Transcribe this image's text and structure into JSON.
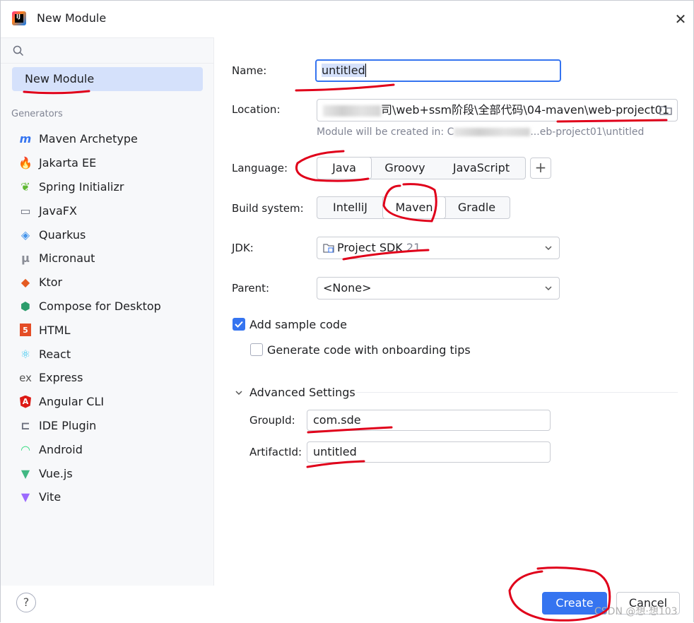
{
  "window": {
    "title": "New Module"
  },
  "sidebar": {
    "selected": "New Module",
    "section_label": "Generators",
    "generators": [
      {
        "label": "Maven Archetype",
        "icon": "maven-icon"
      },
      {
        "label": "Jakarta EE",
        "icon": "jakarta-icon"
      },
      {
        "label": "Spring Initializr",
        "icon": "spring-icon"
      },
      {
        "label": "JavaFX",
        "icon": "javafx-icon"
      },
      {
        "label": "Quarkus",
        "icon": "quarkus-icon"
      },
      {
        "label": "Micronaut",
        "icon": "micronaut-icon"
      },
      {
        "label": "Ktor",
        "icon": "ktor-icon"
      },
      {
        "label": "Compose for Desktop",
        "icon": "compose-icon"
      },
      {
        "label": "HTML",
        "icon": "html5-icon"
      },
      {
        "label": "React",
        "icon": "react-icon"
      },
      {
        "label": "Express",
        "icon": "express-icon"
      },
      {
        "label": "Angular CLI",
        "icon": "angular-icon"
      },
      {
        "label": "IDE Plugin",
        "icon": "plugin-icon"
      },
      {
        "label": "Android",
        "icon": "android-icon"
      },
      {
        "label": "Vue.js",
        "icon": "vue-icon"
      },
      {
        "label": "Vite",
        "icon": "vite-icon"
      }
    ]
  },
  "form": {
    "name_label": "Name:",
    "name_value": "untitled",
    "location_label": "Location:",
    "location_value": "司\\web+ssm阶段\\全部代码\\04-maven\\web-project01",
    "location_hint_prefix": "Module will be created in: C",
    "location_hint_suffix": "...eb-project01\\untitled",
    "language_label": "Language:",
    "languages": [
      "Java",
      "Groovy",
      "JavaScript"
    ],
    "language_selected": "Java",
    "add_language": "+",
    "build_label": "Build system:",
    "builds": [
      "IntelliJ",
      "Maven",
      "Gradle"
    ],
    "build_selected": "Maven",
    "jdk_label": "JDK:",
    "jdk_value": "Project SDK",
    "jdk_version": "21",
    "parent_label": "Parent:",
    "parent_value": "<None>",
    "sample_code_label": "Add sample code",
    "onboarding_label": "Generate code with onboarding tips",
    "advanced_label": "Advanced Settings",
    "groupid_label": "GroupId:",
    "groupid_value": "com.sde",
    "artifactid_label": "ArtifactId:",
    "artifactid_value": "untitled"
  },
  "buttons": {
    "create": "Create",
    "cancel": "Cancel",
    "help": "?"
  },
  "watermark": "CSDN @想·想103",
  "colors": {
    "accent": "#3574f0",
    "selection": "#d5e1fb",
    "annotation": "#e0001a"
  }
}
